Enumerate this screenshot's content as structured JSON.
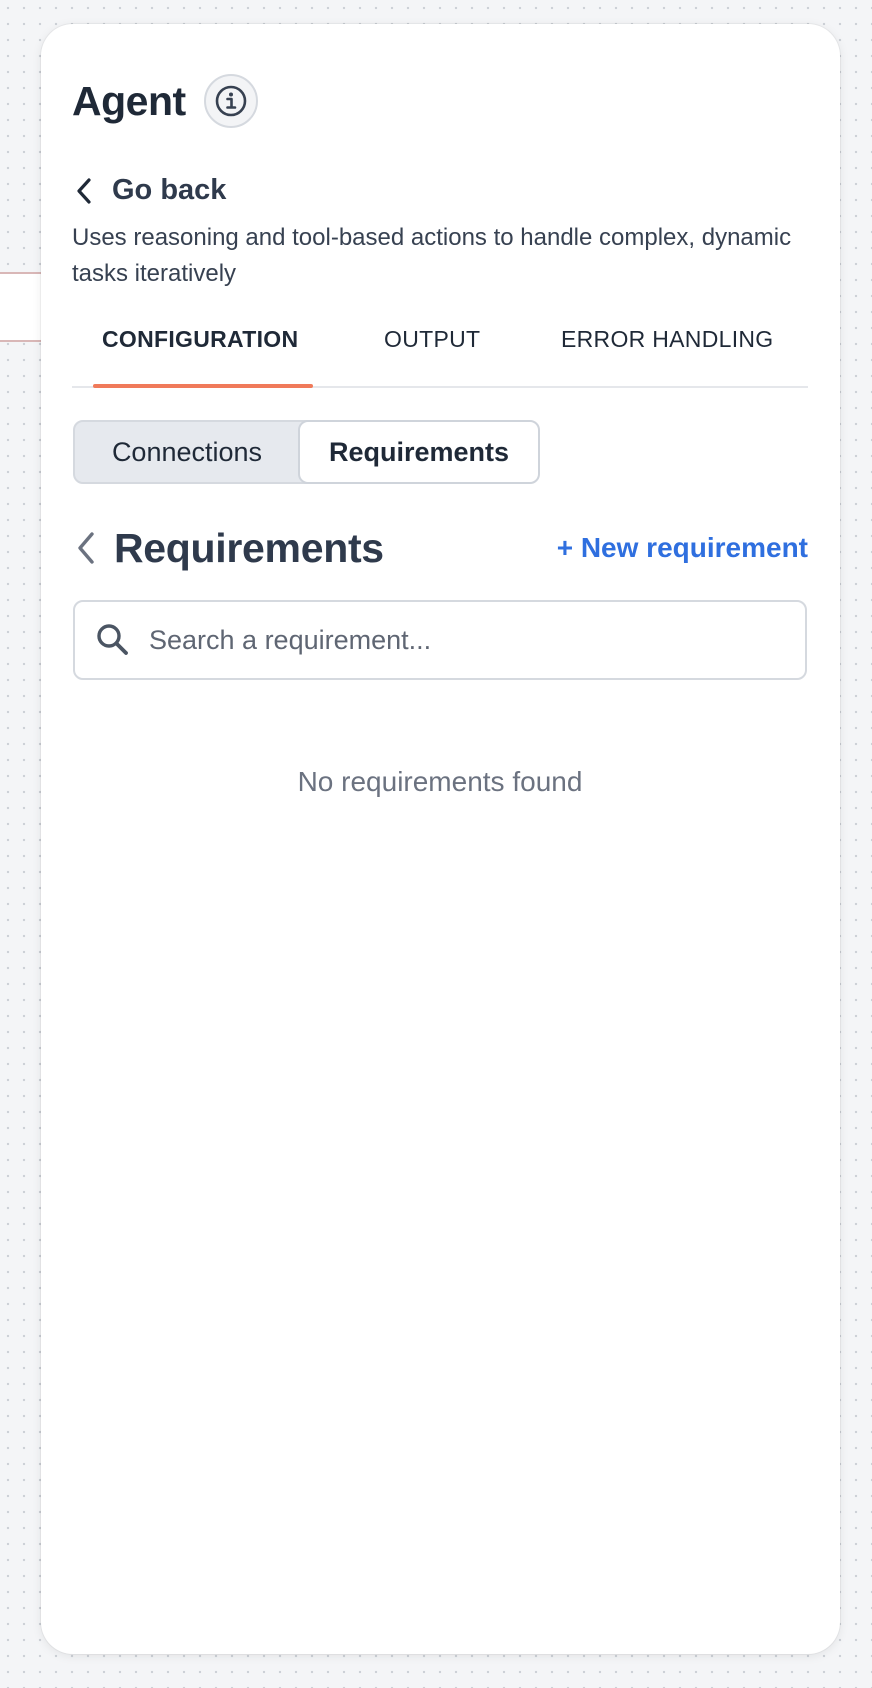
{
  "panel": {
    "title": "Agent",
    "go_back_label": "Go back",
    "description": "Uses reasoning and tool-based actions to handle complex, dynamic tasks iteratively"
  },
  "tabs": [
    {
      "label": "CONFIGURATION",
      "active": true
    },
    {
      "label": "OUTPUT",
      "active": false
    },
    {
      "label": "ERROR HANDLING",
      "active": false
    }
  ],
  "segmented": {
    "connections": "Connections",
    "requirements": "Requirements",
    "selected": "Requirements"
  },
  "requirements": {
    "title": "Requirements",
    "new_button": "+ New requirement",
    "search_placeholder": "Search a requirement...",
    "search_value": "",
    "empty_message": "No requirements found"
  },
  "colors": {
    "accent_tab": "#f07a5a",
    "link_blue": "#2f6fdf",
    "heading": "#2f3a4c"
  },
  "icons": {
    "info": "info-icon",
    "back": "chevron-left-icon",
    "search": "search-icon"
  }
}
